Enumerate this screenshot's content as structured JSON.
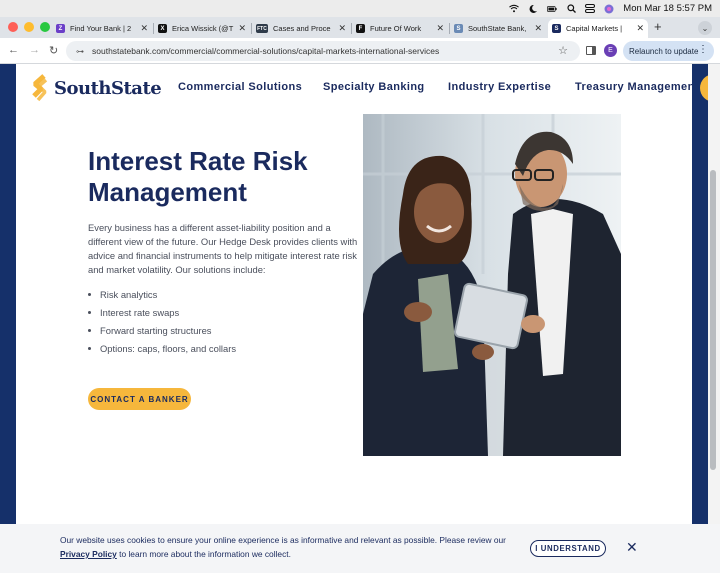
{
  "system": {
    "datetime": "Mon Mar 18  5:57 PM",
    "status_icons": [
      "wifi-icon",
      "focus-icon",
      "battery-icon",
      "search-icon",
      "control-center-icon",
      "siri-icon"
    ]
  },
  "browser": {
    "tabs": [
      {
        "title": "Find Your Bank | 2",
        "favicon": "Z",
        "favicon_color": "#6b3fc8"
      },
      {
        "title": "Erica Wissick (@T",
        "favicon": "X",
        "favicon_color": "#111111"
      },
      {
        "title": "Cases and Proce",
        "favicon": "FTC",
        "favicon_color": "#2f3b4a"
      },
      {
        "title": "Future Of Work",
        "favicon": "F",
        "favicon_color": "#111111"
      },
      {
        "title": "SouthState Bank, ",
        "favicon": "S",
        "favicon_color": "#6a8ab5"
      },
      {
        "title": "Capital Markets | ",
        "favicon": "S",
        "favicon_color": "#1a2a5e"
      }
    ],
    "url": "southstatebank.com/commercial/commercial-solutions/capital-markets-international-services",
    "profile_initial": "E",
    "relaunch_label": "Relaunch to update"
  },
  "site": {
    "logo_text": "SouthState",
    "brand_colors": {
      "navy": "#1a2a5e",
      "gold": "#f6b73c"
    },
    "nav": [
      "Commercial Solutions",
      "Specialty Banking",
      "Industry Expertise",
      "Treasury Management"
    ]
  },
  "hero": {
    "title": "Interest Rate Risk Management",
    "description": "Every business has a different asset-liability position and a different view of the future. Our Hedge Desk provides clients with advice and financial instruments to help mitigate interest rate risk and market volatility. Our solutions include:",
    "list": [
      "Risk analytics",
      "Interest rate swaps",
      "Forward starting structures",
      "Options: caps, floors, and collars"
    ],
    "cta_label": "CONTACT A BANKER",
    "photo": "two-colleagues-with-tablet-photo"
  },
  "cookie_banner": {
    "text_part1": "Our website uses cookies to ensure your online experience is as informative and relevant as possible. Please review our",
    "link_text": "Privacy Policy",
    "text_part2": " to learn more about the information we collect.",
    "button_label": "I UNDERSTAND"
  }
}
